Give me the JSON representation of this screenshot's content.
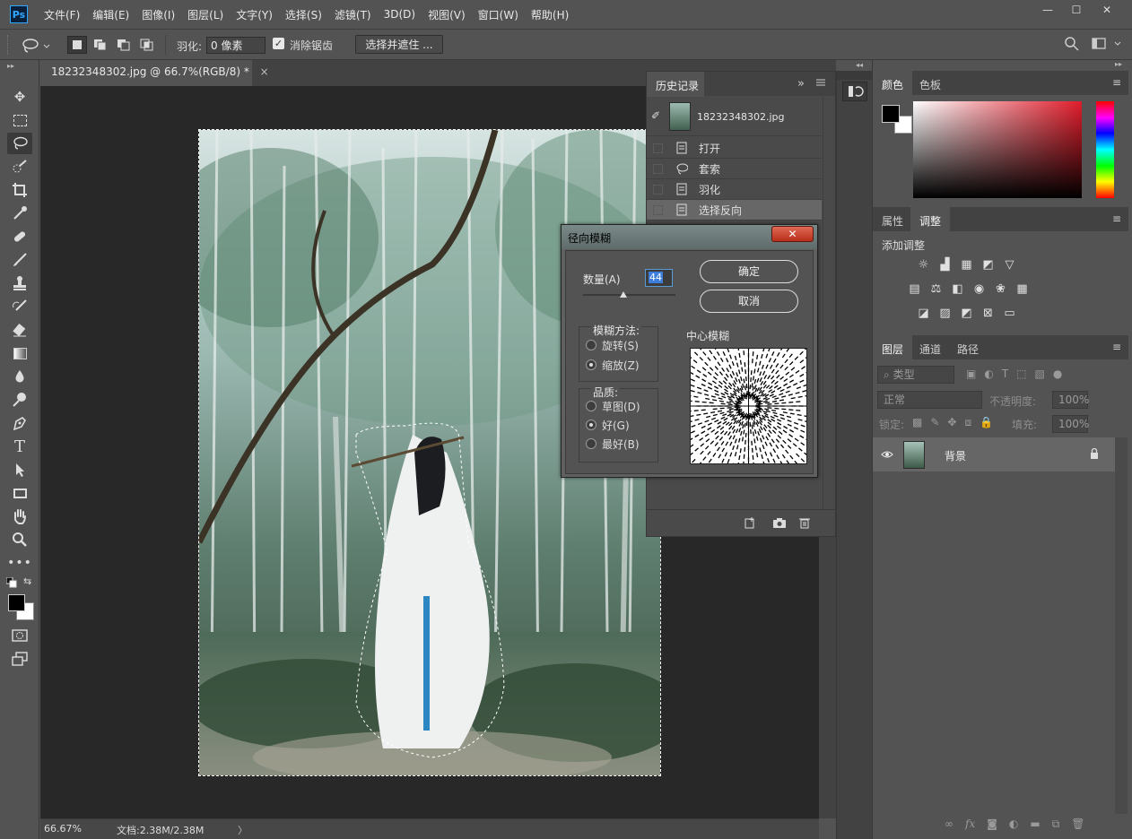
{
  "app": {
    "logo": "Ps"
  },
  "menu": [
    "文件(F)",
    "编辑(E)",
    "图像(I)",
    "图层(L)",
    "文字(Y)",
    "选择(S)",
    "滤镜(T)",
    "3D(D)",
    "视图(V)",
    "窗口(W)",
    "帮助(H)"
  ],
  "window_controls": {
    "minimize": "—",
    "maximize": "☐",
    "close": "✕"
  },
  "options": {
    "feather_label": "羽化:",
    "feather_value": "0 像素",
    "antialias_checked": "✓",
    "antialias_label": "消除锯齿",
    "select_mask": "选择并遮住 ..."
  },
  "document": {
    "tab_title": "18232348302.jpg @ 66.7%(RGB/8) *",
    "tab_close": "×",
    "zoom": "66.67%",
    "doc_size": "文档:2.38M/2.38M",
    "status_arrow": "〉"
  },
  "history": {
    "tab": "历史记录",
    "expand": "»",
    "snapshot": "18232348302.jpg",
    "items": [
      {
        "label": "打开",
        "icon": "document-icon"
      },
      {
        "label": "套索",
        "icon": "lasso-icon"
      },
      {
        "label": "羽化",
        "icon": "document-icon"
      },
      {
        "label": "选择反向",
        "icon": "document-icon",
        "selected": true
      }
    ]
  },
  "color_panel": {
    "tabs": [
      "颜色",
      "色板"
    ],
    "accent": "#e11d2b"
  },
  "adjust_panel": {
    "tabs": [
      "属性",
      "调整"
    ],
    "title": "添加调整"
  },
  "layers_panel": {
    "tabs": [
      "图层",
      "通道",
      "路径"
    ],
    "kind_filter": "类型",
    "blend_mode": "正常",
    "opacity_label": "不透明度:",
    "opacity_value": "100%",
    "lock_label": "锁定:",
    "fill_label": "填充:",
    "fill_value": "100%",
    "layers": [
      {
        "name": "背景",
        "locked": true
      }
    ]
  },
  "dialog": {
    "title": "径向模糊",
    "close": "✕",
    "amount_label": "数量(A)",
    "amount_value": "44",
    "amount_fraction": 0.44,
    "ok": "确定",
    "cancel": "取消",
    "method_title": "模糊方法:",
    "methods": [
      {
        "label": "旋转(S)",
        "on": false
      },
      {
        "label": "缩放(Z)",
        "on": true
      }
    ],
    "quality_title": "品质:",
    "qualities": [
      {
        "label": "草图(D)",
        "on": false
      },
      {
        "label": "好(G)",
        "on": true
      },
      {
        "label": "最好(B)",
        "on": false
      }
    ],
    "center_label": "中心模糊"
  }
}
